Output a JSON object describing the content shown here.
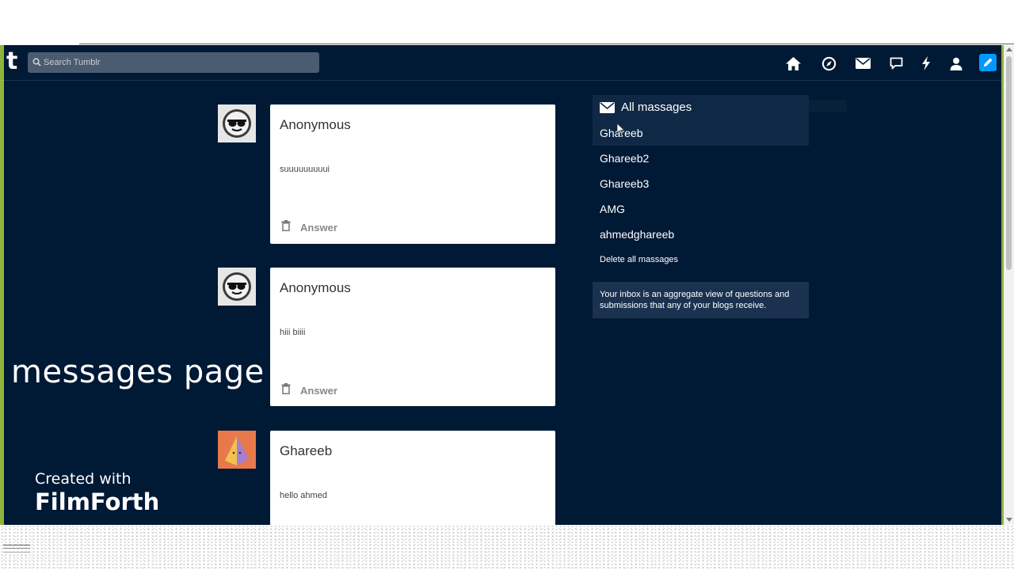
{
  "navbar": {
    "logo": "t",
    "search_placeholder": "Search Tumblr",
    "icons": [
      "home-icon",
      "explore-icon",
      "mail-icon",
      "chat-icon",
      "activity-icon",
      "account-icon",
      "compose-icon"
    ],
    "compose_color": "#0099ff"
  },
  "posts": [
    {
      "author": "Anonymous",
      "body": "suuuuuuuuui",
      "answer_label": "Answer",
      "avatar": "sunglasses-avatar"
    },
    {
      "author": "Anonymous",
      "body": "hiii biiii",
      "answer_label": "Answer",
      "avatar": "sunglasses-avatar"
    },
    {
      "author": "Ghareeb",
      "body": "hello ahmed",
      "avatar": "pyramid-avatar"
    }
  ],
  "sidebar": {
    "title": "All massages",
    "items": [
      "Ghareeb",
      "Ghareeb2",
      "Ghareeb3",
      "AMG",
      "ahmedghareeb"
    ],
    "delete_label": "Delete all massages",
    "info": "Your inbox is an aggregate view of questions and submissions that any of your blogs receive."
  },
  "overlay": {
    "caption": "messages page",
    "watermark_line1": "Created with",
    "watermark_line2": "FilmForth"
  },
  "colors": {
    "background": "#001935",
    "accent": "#8fb43a",
    "card": "#ffffff",
    "sidebar_highlight": "#0f2845"
  }
}
